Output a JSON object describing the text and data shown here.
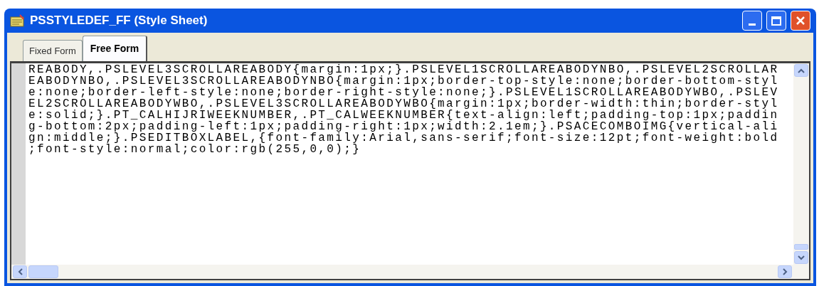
{
  "window": {
    "title": "PSSTYLEDEF_FF (Style Sheet)"
  },
  "tabs": [
    {
      "label": "Fixed Form",
      "selected": false
    },
    {
      "label": "Free Form",
      "selected": true
    }
  ],
  "editor": {
    "lines": [
      "REABODY,.PSLEVEL3SCROLLAREABODY{margin:1px;}.PSLEVEL1SCROLLAREABODYNBO,.PSLEVEL2SCROLLAR",
      "EABODYNBO,.PSLEVEL3SCROLLAREABODYNBO{margin:1px;border-top-style:none;border-bottom-styl",
      "e:none;border-left-style:none;border-right-style:none;}.PSLEVEL1SCROLLAREABODYWBO,.PSLEV",
      "EL2SCROLLAREABODYWBO,.PSLEVEL3SCROLLAREABODYWBO{margin:1px;border-width:thin;border-styl",
      "e:solid;}.PT_CALHIJRIWEEKNUMBER,.PT_CALWEEKNUMBER{text-align:left;padding-top:1px;paddin",
      "g-bottom:2px;padding-left:1px;padding-right:1px;width:2.1em;}.PSACECOMBOIMG{vertical-ali",
      "gn:middle;}.PSEDITBOXLABEL,{font-family:Arial,sans-serif;font-size:12pt;font-weight:bold",
      ";font-style:normal;color:rgb(255,0,0);}"
    ]
  }
}
